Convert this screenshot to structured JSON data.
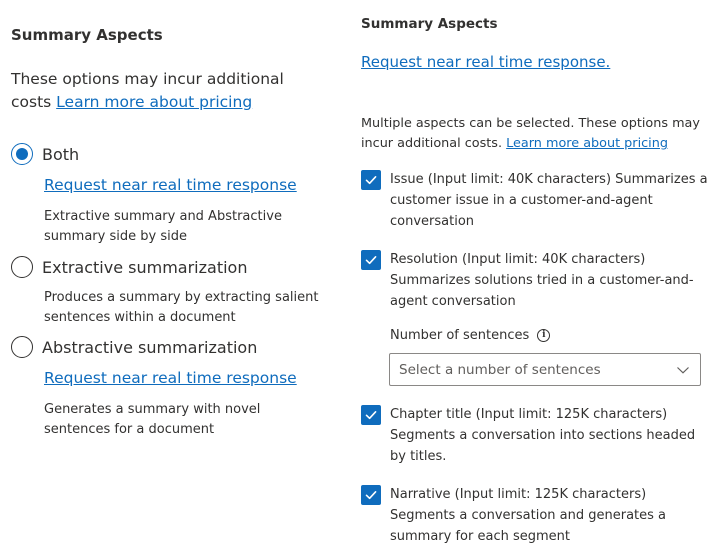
{
  "left": {
    "title": "Summary Aspects",
    "intro_text": "These options may incur additional costs",
    "intro_link": "Learn more about pricing",
    "options": [
      {
        "label": "Both",
        "checked": true,
        "link": "Request near real time response",
        "description": "Extractive summary and Abstractive summary side by side"
      },
      {
        "label": "Extractive summarization",
        "checked": false,
        "link": "",
        "description": "Produces a summary by extracting salient sentences within a document"
      },
      {
        "label": "Abstractive summarization",
        "checked": false,
        "link": "Request near real time response",
        "description": "Generates a summary with novel sentences for a document"
      }
    ]
  },
  "right": {
    "title": "Summary Aspects",
    "top_link": "Request near real time response.",
    "intro_text": "Multiple aspects can be selected. These options may incur additional costs.",
    "intro_link": "Learn more about pricing",
    "aspects": [
      {
        "label": "Issue (Input limit: 40K characters) Summarizes a customer issue in a customer-and-agent conversation",
        "checked": true
      },
      {
        "label": "Resolution (Input limit: 40K characters) Summarizes solutions tried in a customer-and-agent conversation",
        "checked": true
      },
      {
        "label": "Chapter title (Input limit: 125K characters) Segments a conversation into sections headed by titles.",
        "checked": true
      },
      {
        "label": "Narrative (Input limit: 125K characters) Segments a conversation and generates a summary for each segment",
        "checked": true
      }
    ],
    "sentences": {
      "label": "Number of sentences",
      "placeholder": "Select a number of sentences"
    }
  },
  "colors": {
    "accent": "#0f6cbd",
    "text": "#323130",
    "placeholder": "#605e5c"
  },
  "icons": {
    "info": "info-icon",
    "chevron": "chevron-down-icon",
    "check": "checkmark-icon"
  }
}
